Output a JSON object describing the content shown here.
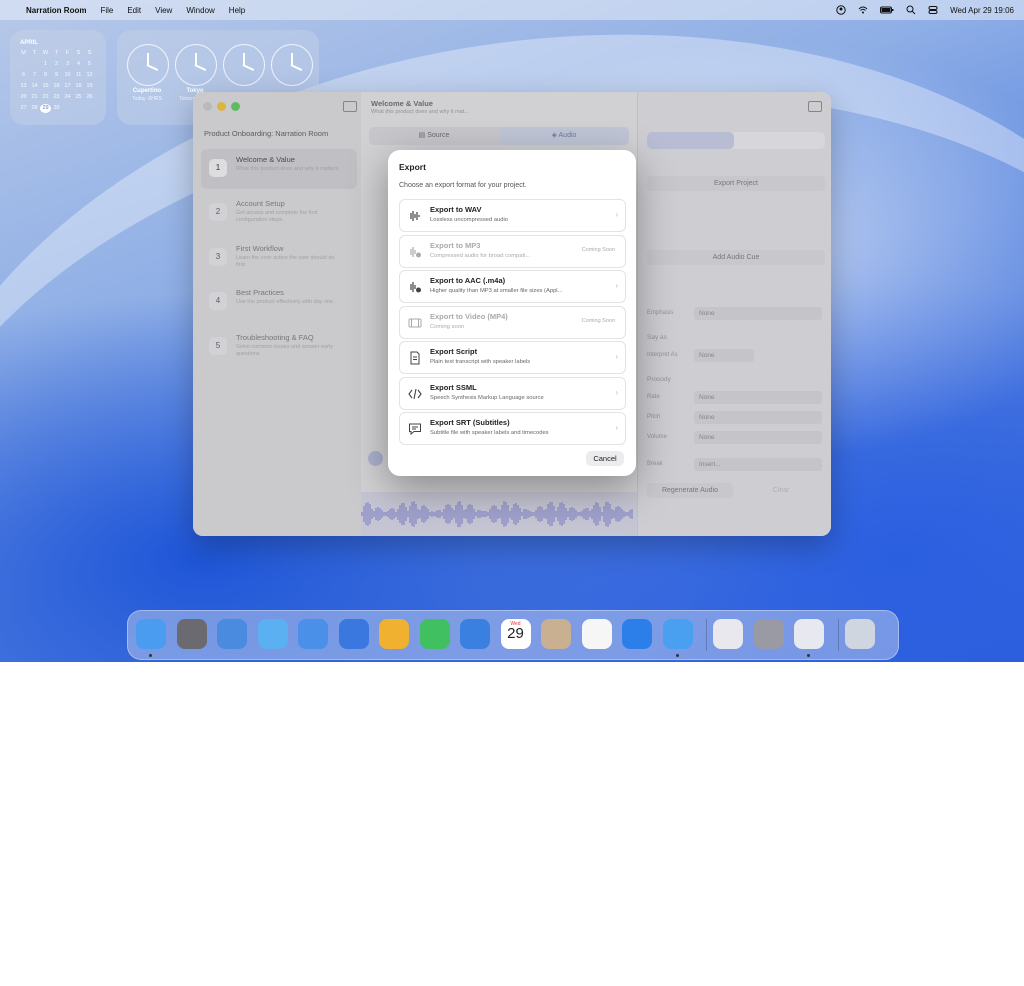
{
  "menubar": {
    "app_name": "Narration Room",
    "menus": [
      "File",
      "Edit",
      "View",
      "Window",
      "Help"
    ],
    "datetime": "Wed Apr 29  19:06"
  },
  "calendar_widget": {
    "month": "APRIL",
    "weekdays": [
      "M",
      "T",
      "W",
      "T",
      "F",
      "S",
      "S"
    ],
    "days": [
      "",
      "",
      "1",
      "2",
      "3",
      "4",
      "5",
      "6",
      "7",
      "8",
      "9",
      "10",
      "11",
      "12",
      "13",
      "14",
      "15",
      "16",
      "17",
      "18",
      "19",
      "20",
      "21",
      "22",
      "23",
      "24",
      "25",
      "26",
      "27",
      "28",
      "29",
      "30",
      "",
      "",
      ""
    ],
    "today": "29"
  },
  "clock_widget": {
    "clocks": [
      {
        "city": "Cupertino",
        "sub": "Today -0HRS"
      },
      {
        "city": "Tokyo",
        "sub": "Tomorrow +16"
      },
      {
        "city": "",
        "sub": ""
      },
      {
        "city": "",
        "sub": ""
      }
    ]
  },
  "sidebar": {
    "project_title": "Product Onboarding: Narration Room",
    "steps": [
      {
        "num": "1",
        "title": "Welcome & Value",
        "desc": "What this product does and why it matters."
      },
      {
        "num": "2",
        "title": "Account Setup",
        "desc": "Get access and complete the first configuration steps."
      },
      {
        "num": "3",
        "title": "First Workflow",
        "desc": "Learn the core action the user should do first."
      },
      {
        "num": "4",
        "title": "Best Practices",
        "desc": "Use the product effectively with day one."
      },
      {
        "num": "5",
        "title": "Troubleshooting & FAQ",
        "desc": "Solve common issues and answer early questions."
      }
    ]
  },
  "main": {
    "title": "Welcome & Value",
    "subtitle": "What this product does and why it mat...",
    "tabs": [
      "Source",
      "Audio"
    ]
  },
  "inspector": {
    "export_project": "Export Project",
    "add_audio_cue": "Add Audio Cue",
    "emphasis_label": "Emphasis",
    "emphasis_value": "None",
    "say_as_label": "Say as",
    "interpret_label": "Interpret As",
    "interpret_value": "None",
    "prosody_label": "Prosody",
    "rate_label": "Rate",
    "rate_value": "None",
    "pitch_label": "Pitch",
    "pitch_value": "None",
    "volume_label": "Volume",
    "volume_value": "None",
    "break_label": "Break",
    "break_value": "Insert...",
    "regenerate": "Regenerate Audio",
    "clear": "Clear"
  },
  "dialog": {
    "title": "Export",
    "subtitle": "Choose an export format for your project.",
    "options": [
      {
        "title": "Export to WAV",
        "desc": "Lossless uncompressed audio",
        "badge": "",
        "icon": "waveform-icon",
        "disabled": false
      },
      {
        "title": "Export to MP3",
        "desc": "Compressed audio for broad compati...",
        "badge": "Coming Soon",
        "icon": "waveform-badge-icon",
        "disabled": true
      },
      {
        "title": "Export to AAC (.m4a)",
        "desc": "Higher quality than MP3 at smaller file sizes (Appl...",
        "badge": "",
        "icon": "waveform-badge-icon",
        "disabled": false
      },
      {
        "title": "Export to Video (MP4)",
        "desc": "Coming soon",
        "badge": "Coming Soon",
        "icon": "film-icon",
        "disabled": true
      },
      {
        "title": "Export Script",
        "desc": "Plain text transcript with speaker labels",
        "badge": "",
        "icon": "document-icon",
        "disabled": false
      },
      {
        "title": "Export SSML",
        "desc": "Speech Synthesis Markup Language source",
        "badge": "",
        "icon": "code-icon",
        "disabled": false
      },
      {
        "title": "Export SRT (Subtitles)",
        "desc": "Subtitle file with speaker labels and timecodes",
        "badge": "",
        "icon": "caption-icon",
        "disabled": false
      }
    ],
    "cancel_label": "Cancel"
  },
  "dock": {
    "calendar_month": "Wed",
    "calendar_day": "29",
    "apps": [
      "finder-icon",
      "calculator-icon",
      "safari-icon",
      "messages-icon",
      "mail-icon",
      "xcode-icon",
      "photos-icon",
      "facetime-icon",
      "phone-icon",
      "calendar-icon",
      "contacts-icon",
      "reminders-icon",
      "app-icon-1",
      "app-icon-2",
      "preview-icon",
      "system-settings-icon",
      "grid-app-icon",
      "trash-icon"
    ]
  }
}
